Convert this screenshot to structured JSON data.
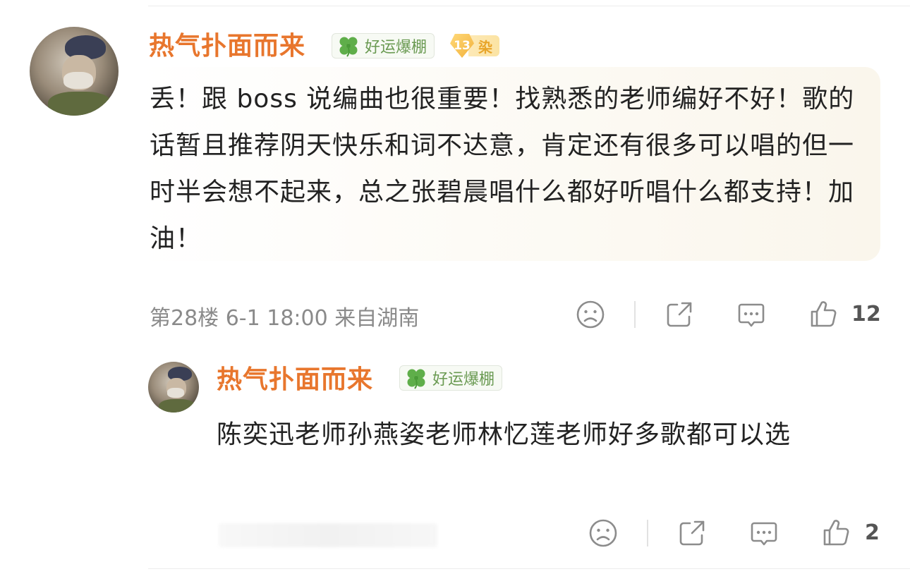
{
  "comment": {
    "username": "热气扑面而来",
    "badge_label": "好运爆棚",
    "fan_level": "13",
    "fan_label": "染",
    "text": "丢！跟 boss 说编曲也很重要！找熟悉的老师编好不好！歌的话暂且推荐阴天快乐和词不达意，肯定还有很多可以唱的但一时半会想不起来，总之张碧晨唱什么都好听唱什么都支持！加油！",
    "meta": "第28楼 6-1 18:00 来自湖南",
    "like_count": "12"
  },
  "reply": {
    "username": "热气扑面而来",
    "badge_label": "好运爆棚",
    "text": "陈奕迅老师孙燕姿老师林忆莲老师好多歌都可以选",
    "like_count": "2"
  },
  "colors": {
    "username": "#e8762d",
    "badge_text": "#6a9a52",
    "meta": "#8a8a8a",
    "icon": "#8c8c8c"
  },
  "icons": [
    "sad-face-icon",
    "share-icon",
    "comment-icon",
    "thumbs-up-icon",
    "clover-icon"
  ]
}
